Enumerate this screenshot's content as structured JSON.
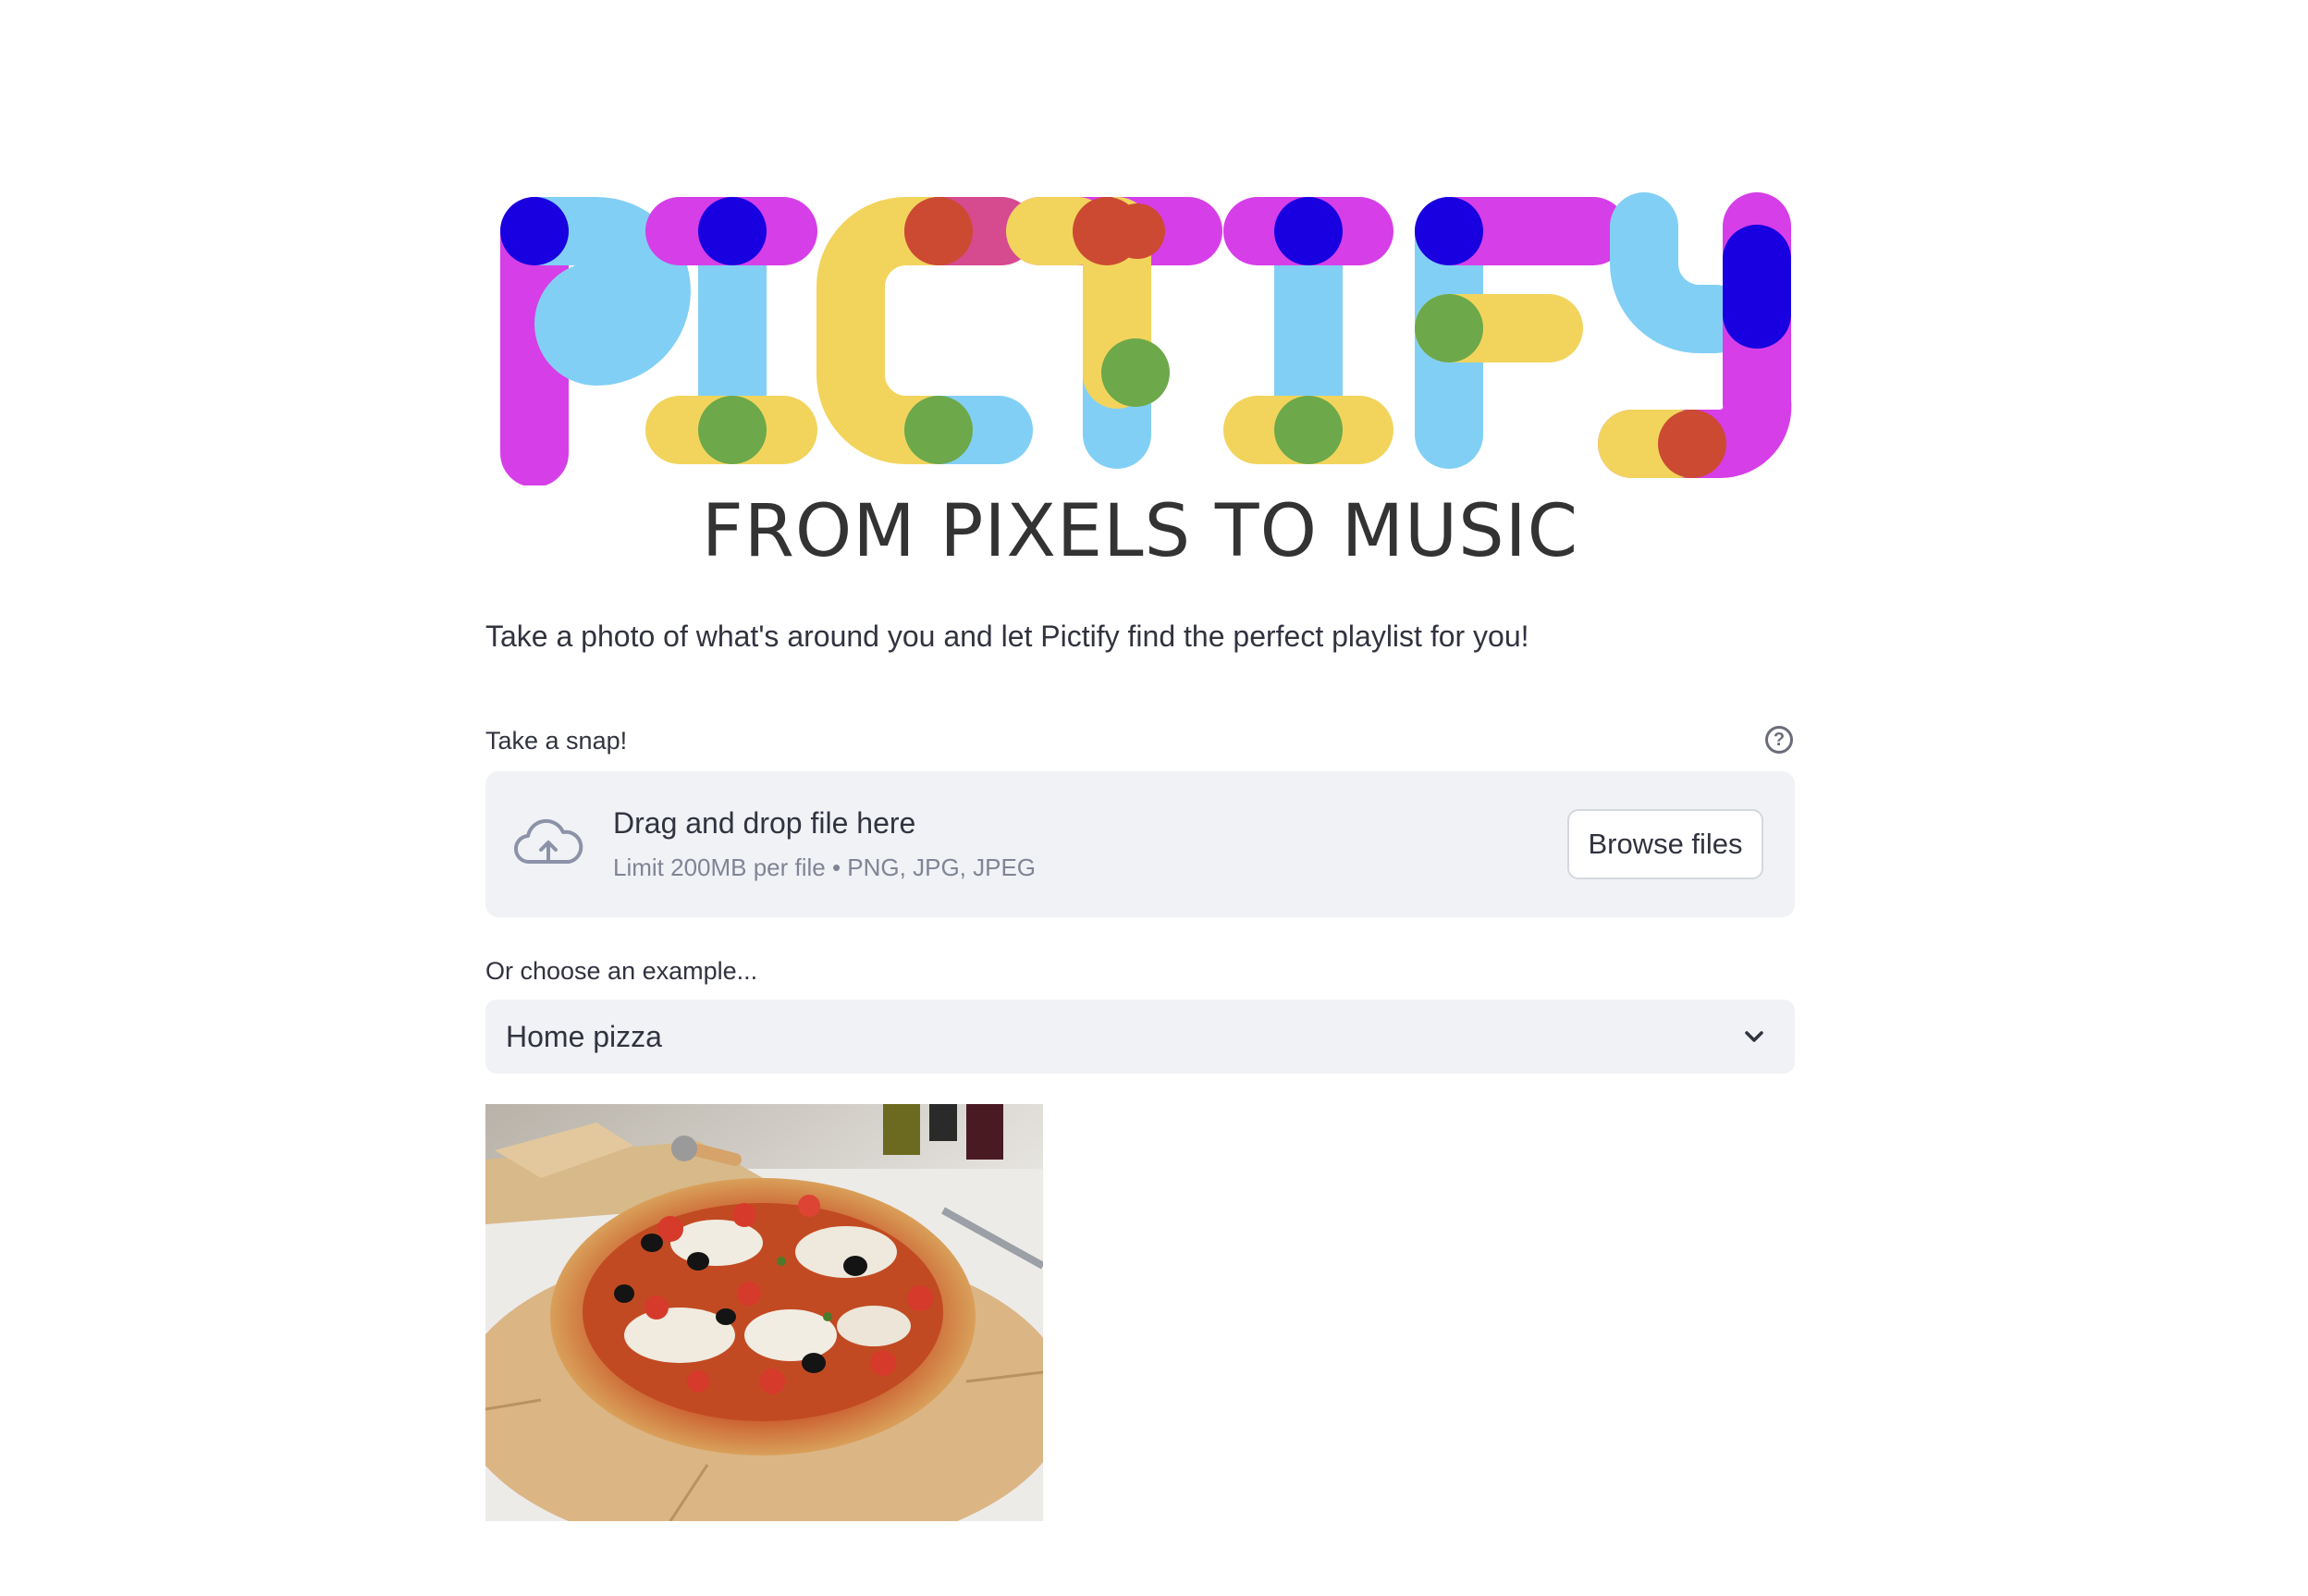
{
  "logo": {
    "wordmark": "PICTIFY",
    "tagline": "FROM PIXELS TO MUSIC"
  },
  "intro_text": "Take a photo of what's around you and let Pictify find the perfect playlist for you!",
  "uploader": {
    "label": "Take a snap!",
    "help_icon": "question-circle-icon",
    "title": "Drag and drop file here",
    "subtitle": "Limit 200MB per file • PNG, JPG, JPEG",
    "browse_label": "Browse files",
    "cloud_icon": "cloud-upload-icon"
  },
  "example_select": {
    "label": "Or choose an example...",
    "selected": "Home pizza",
    "chevron_icon": "chevron-down-icon"
  },
  "colors": {
    "magenta": "#d63ee8",
    "blue": "#1800e0",
    "sky": "#82cff5",
    "yellow": "#f2d45c",
    "red": "#cc4a32",
    "green": "#6da84a",
    "panel": "#f0f2f6"
  }
}
